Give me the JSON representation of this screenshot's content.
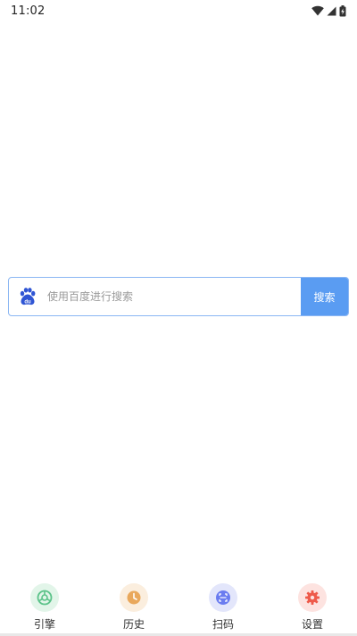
{
  "status_bar": {
    "time": "11:02",
    "icons": [
      "wifi-icon",
      "signal-icon",
      "battery-charging-icon"
    ]
  },
  "search": {
    "engine_icon": "baidu-paw-icon",
    "placeholder": "使用百度进行搜索",
    "value": "",
    "button_label": "搜索",
    "accent_color": "#5a9cf2",
    "border_color": "#8ab6f3"
  },
  "bottom_nav": {
    "items": [
      {
        "label": "引擎",
        "icon": "engine-icon",
        "color": "#5cc38a",
        "bg": "#e2f5e9"
      },
      {
        "label": "历史",
        "icon": "clock-icon",
        "color": "#e9a85c",
        "bg": "#fbeede"
      },
      {
        "label": "扫码",
        "icon": "scan-icon",
        "color": "#6a7cf0",
        "bg": "#e3e6fb"
      },
      {
        "label": "设置",
        "icon": "gear-icon",
        "color": "#ee5a4a",
        "bg": "#fde3e0"
      }
    ]
  }
}
